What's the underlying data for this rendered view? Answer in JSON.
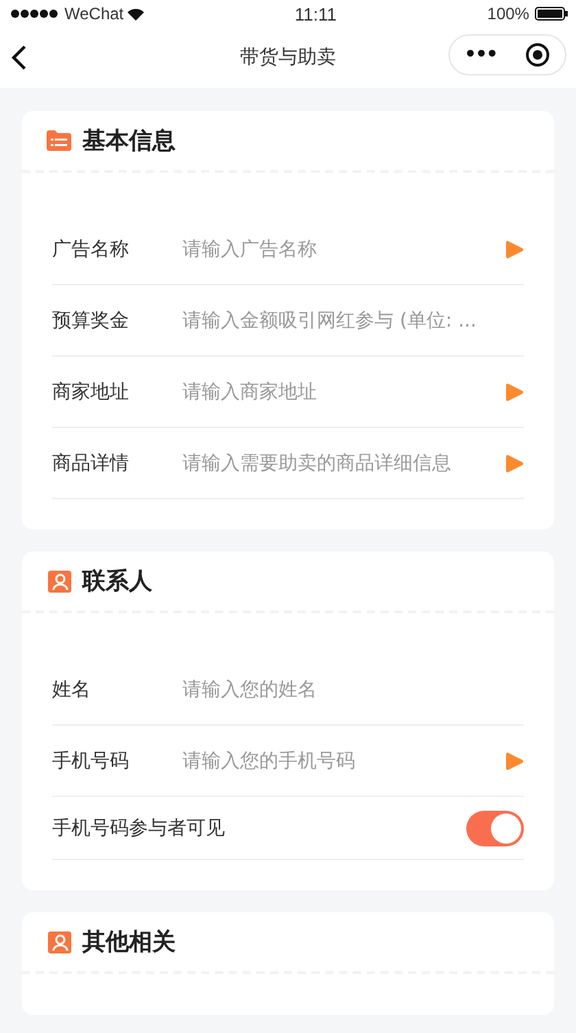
{
  "status_bar": {
    "carrier": "WeChat",
    "time": "11:11",
    "battery": "100%"
  },
  "nav": {
    "title": "带货与助卖",
    "more": "•••"
  },
  "sections": [
    {
      "title": "基本信息",
      "kind": "list",
      "rows": [
        {
          "kind": "input",
          "label": "广告名称",
          "placeholder": "请输入广告名称",
          "arrow": true
        },
        {
          "kind": "input",
          "label": "预算奖金",
          "placeholder": "请输入金额吸引网红参与 (单位: ...",
          "arrow": false
        },
        {
          "kind": "input",
          "label": "商家地址",
          "placeholder": "请输入商家地址",
          "arrow": true
        },
        {
          "kind": "input",
          "label": "商品详情",
          "placeholder": "请输入需要助卖的商品详细信息",
          "arrow": true
        }
      ]
    },
    {
      "title": "联系人",
      "kind": "person",
      "rows": [
        {
          "kind": "input",
          "label": "姓名",
          "placeholder": "请输入您的姓名",
          "arrow": false
        },
        {
          "kind": "input",
          "label": "手机号码",
          "placeholder": "请输入您的手机号码",
          "arrow": true
        },
        {
          "kind": "toggle",
          "label": "手机号码参与者可见",
          "on": true
        }
      ]
    },
    {
      "title": "其他相关",
      "kind": "person"
    }
  ]
}
